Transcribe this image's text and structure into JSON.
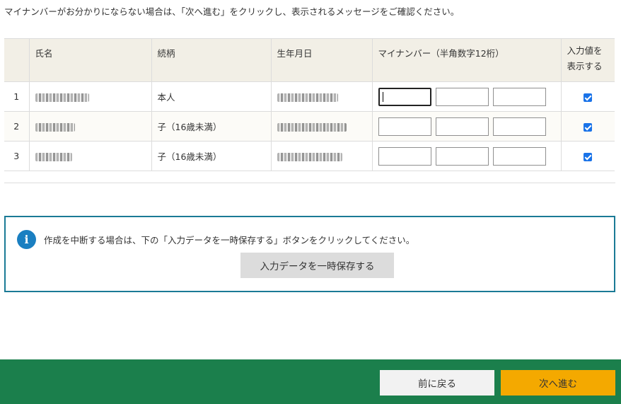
{
  "notice": "マイナンバーがお分かりにならない場合は、「次へ進む」をクリックし、表示されるメッセージをご確認ください。",
  "table": {
    "headers": {
      "name": "氏名",
      "relation": "続柄",
      "birthdate": "生年月日",
      "mynumber": "マイナンバー（半角数字12桁）",
      "show_line1": "入力値を",
      "show_line2": "表示する"
    },
    "rows": [
      {
        "no": "1",
        "relation": "本人",
        "checked": true
      },
      {
        "no": "2",
        "relation": "子（16歳未満）",
        "checked": true
      },
      {
        "no": "3",
        "relation": "子（16歳未満）",
        "checked": true
      }
    ]
  },
  "info": {
    "icon": "info-icon",
    "text": "作成を中断する場合は、下の「入力データを一時保存する」ボタンをクリックしてください。",
    "save_label": "入力データを一時保存する"
  },
  "footer": {
    "back_label": "前に戻る",
    "next_label": "次へ進む"
  },
  "colors": {
    "footer_bg": "#1b7f4c",
    "next_button": "#f4a900",
    "info_border": "#1a7a96",
    "header_bg": "#f2efe6"
  }
}
